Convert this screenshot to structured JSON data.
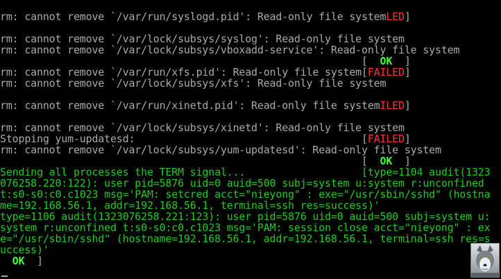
{
  "colors": {
    "background": "#000000",
    "default": "#aaaaaa",
    "red": "#ff3333",
    "green": "#22cc22",
    "bright_green": "#44ff44"
  },
  "terminal": {
    "lines": [
      [
        {
          "t": "rm: cannot remove `/var/run/syslogd.pid': Read-only file system",
          "c": "default"
        },
        {
          "t": "LED",
          "c": "red"
        },
        {
          "t": "]",
          "c": "default"
        }
      ],
      [
        {
          "t": "",
          "c": "default"
        }
      ],
      [
        {
          "t": "rm: cannot remove `/var/lock/subsys/syslog': Read-only file system",
          "c": "default"
        }
      ],
      [
        {
          "t": "rm: cannot remove `/var/lock/subsys/vboxadd-service': Read-only file system",
          "c": "default"
        }
      ],
      [
        {
          "t": "                                                           [  ",
          "c": "default"
        },
        {
          "t": "OK",
          "c": "bright"
        },
        {
          "t": "  ]",
          "c": "default"
        }
      ],
      [
        {
          "t": "rm: cannot remove `/var/run/xfs.pid': Read-only file system",
          "c": "default"
        },
        {
          "t": "[",
          "c": "default"
        },
        {
          "t": "FAILED",
          "c": "red"
        },
        {
          "t": "]",
          "c": "default"
        }
      ],
      [
        {
          "t": "rm: cannot remove `/var/lock/subsys/xfs': Read-only file system",
          "c": "default"
        }
      ],
      [
        {
          "t": "",
          "c": "default"
        }
      ],
      [
        {
          "t": "rm: cannot remove `/var/run/xinetd.pid': Read-only file system",
          "c": "default"
        },
        {
          "t": "ILED",
          "c": "red"
        },
        {
          "t": "]",
          "c": "default"
        }
      ],
      [
        {
          "t": "",
          "c": "default"
        }
      ],
      [
        {
          "t": "rm: cannot remove `/var/lock/subsys/xinetd': Read-only file system",
          "c": "default"
        }
      ],
      [
        {
          "t": "Stopping yum-updatesd:                                     [",
          "c": "default"
        },
        {
          "t": "FAILED",
          "c": "red"
        },
        {
          "t": "]",
          "c": "default"
        }
      ],
      [
        {
          "t": "rm: cannot remove `/var/lock/subsys/yum-updatesd': Read-only file system",
          "c": "default"
        }
      ],
      [
        {
          "t": "                                                           [  ",
          "c": "default"
        },
        {
          "t": "OK",
          "c": "bright"
        },
        {
          "t": "  ]",
          "c": "default"
        }
      ],
      [
        {
          "t": "Sending all processes the TERM signal...                   [type=1104 audit(1323",
          "c": "green"
        }
      ],
      [
        {
          "t": "076258.220:122): user pid=5876 uid=0 auid=500 subj=system_u:system_r:unconfined_",
          "c": "green"
        }
      ],
      [
        {
          "t": "t:s0-s0:c0.c1023 msg='PAM: setcred acct=\"nieyong\" : exe=\"/usr/sbin/sshd\" (hostna",
          "c": "green"
        }
      ],
      [
        {
          "t": "me=192.168.56.1, addr=192.168.56.1, terminal=ssh res=success)'",
          "c": "green"
        }
      ],
      [
        {
          "t": "type=1106 audit(1323076258.221:123): user pid=5876 uid=0 auid=500 subj=system_u:",
          "c": "green"
        }
      ],
      [
        {
          "t": "system_r:unconfined_t:s0-s0:c0.c1023 msg='PAM: session close acct=\"nieyong\" : ex",
          "c": "green"
        }
      ],
      [
        {
          "t": "e=\"/usr/sbin/sshd\" (hostname=192.168.56.1, addr=192.168.56.1, terminal=ssh res=s",
          "c": "green"
        }
      ],
      [
        {
          "t": "uccess)'",
          "c": "green"
        }
      ],
      [
        {
          "t": "  ",
          "c": "default"
        },
        {
          "t": "OK",
          "c": "bright"
        },
        {
          "t": "  ]",
          "c": "default"
        }
      ]
    ]
  },
  "corner_image": {
    "icon": "wolf-icon"
  }
}
